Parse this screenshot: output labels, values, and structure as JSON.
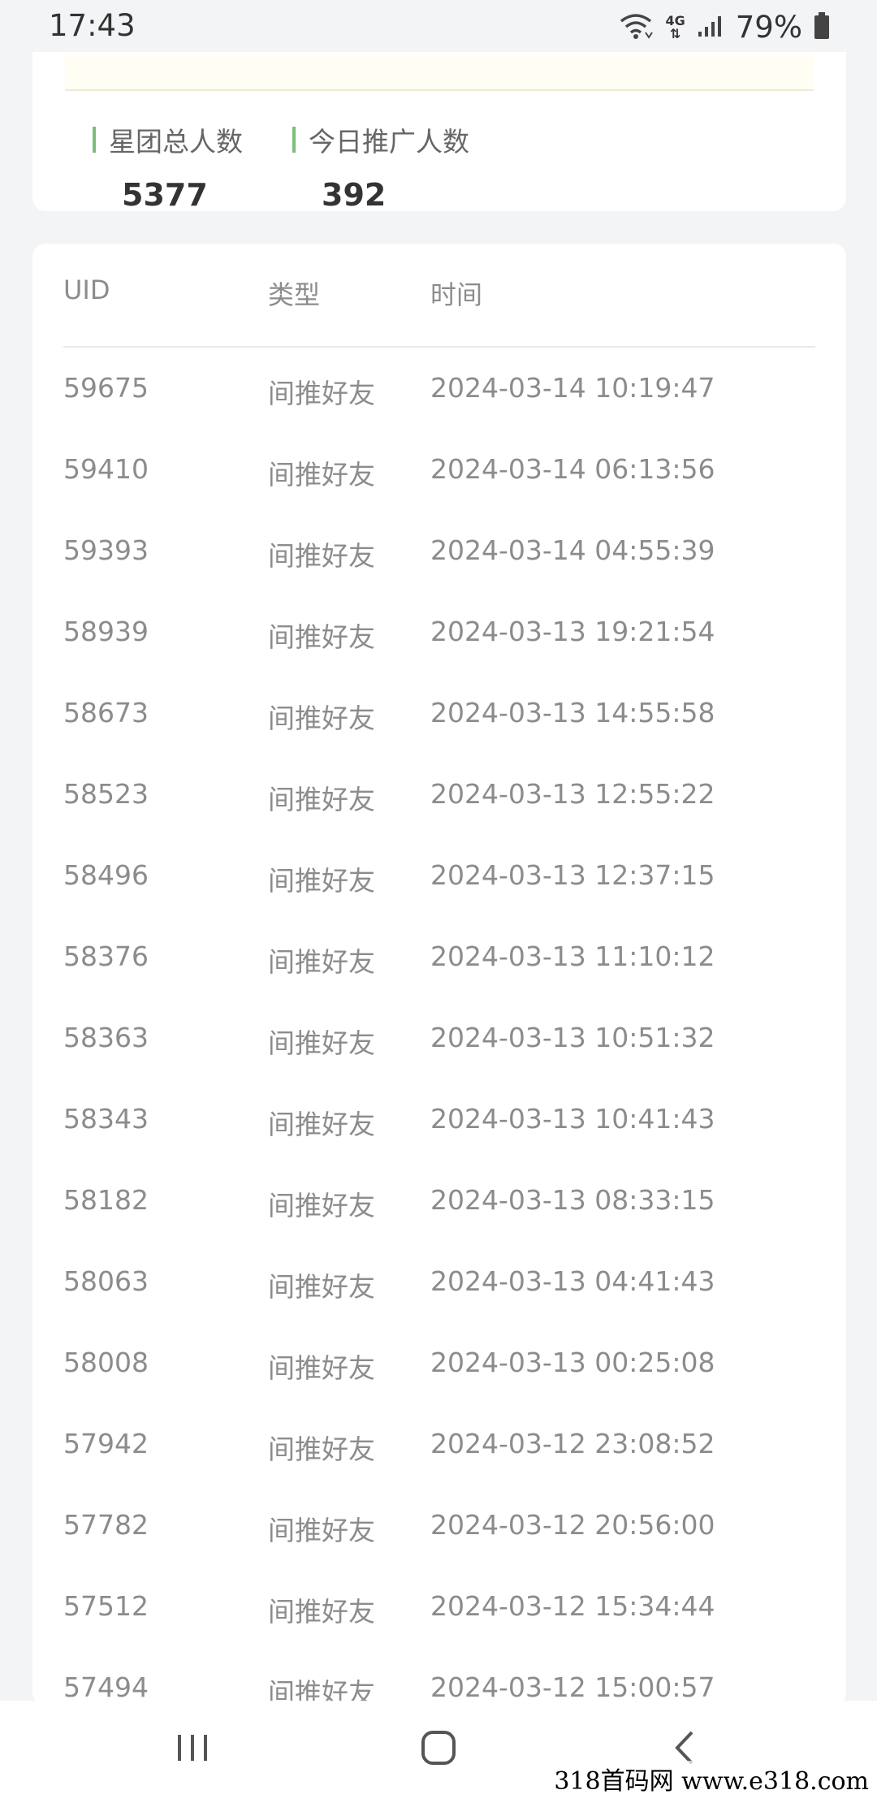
{
  "status_bar": {
    "time": "17:43",
    "network": "4G",
    "battery": "79%"
  },
  "summary": {
    "total_label": "星团总人数",
    "total_value": "5377",
    "today_label": "今日推广人数",
    "today_value": "392",
    "accent_color": "#7dbe7c"
  },
  "table": {
    "headers": {
      "uid": "UID",
      "type": "类型",
      "time": "时间"
    },
    "rows": [
      {
        "uid": "59675",
        "type": "间推好友",
        "time": "2024-03-14 10:19:47"
      },
      {
        "uid": "59410",
        "type": "间推好友",
        "time": "2024-03-14 06:13:56"
      },
      {
        "uid": "59393",
        "type": "间推好友",
        "time": "2024-03-14 04:55:39"
      },
      {
        "uid": "58939",
        "type": "间推好友",
        "time": "2024-03-13 19:21:54"
      },
      {
        "uid": "58673",
        "type": "间推好友",
        "time": "2024-03-13 14:55:58"
      },
      {
        "uid": "58523",
        "type": "间推好友",
        "time": "2024-03-13 12:55:22"
      },
      {
        "uid": "58496",
        "type": "间推好友",
        "time": "2024-03-13 12:37:15"
      },
      {
        "uid": "58376",
        "type": "间推好友",
        "time": "2024-03-13 11:10:12"
      },
      {
        "uid": "58363",
        "type": "间推好友",
        "time": "2024-03-13 10:51:32"
      },
      {
        "uid": "58343",
        "type": "间推好友",
        "time": "2024-03-13 10:41:43"
      },
      {
        "uid": "58182",
        "type": "间推好友",
        "time": "2024-03-13 08:33:15"
      },
      {
        "uid": "58063",
        "type": "间推好友",
        "time": "2024-03-13 04:41:43"
      },
      {
        "uid": "58008",
        "type": "间推好友",
        "time": "2024-03-13 00:25:08"
      },
      {
        "uid": "57942",
        "type": "间推好友",
        "time": "2024-03-12 23:08:52"
      },
      {
        "uid": "57782",
        "type": "间推好友",
        "time": "2024-03-12 20:56:00"
      },
      {
        "uid": "57512",
        "type": "间推好友",
        "time": "2024-03-12 15:34:44"
      },
      {
        "uid": "57494",
        "type": "间推好友",
        "time": "2024-03-12 15:00:57"
      }
    ]
  },
  "nav": {
    "recent_icon": "recent-apps-icon",
    "home_icon": "home-icon",
    "back_icon": "back-icon"
  },
  "watermark": "318首码网 www.e318.com"
}
